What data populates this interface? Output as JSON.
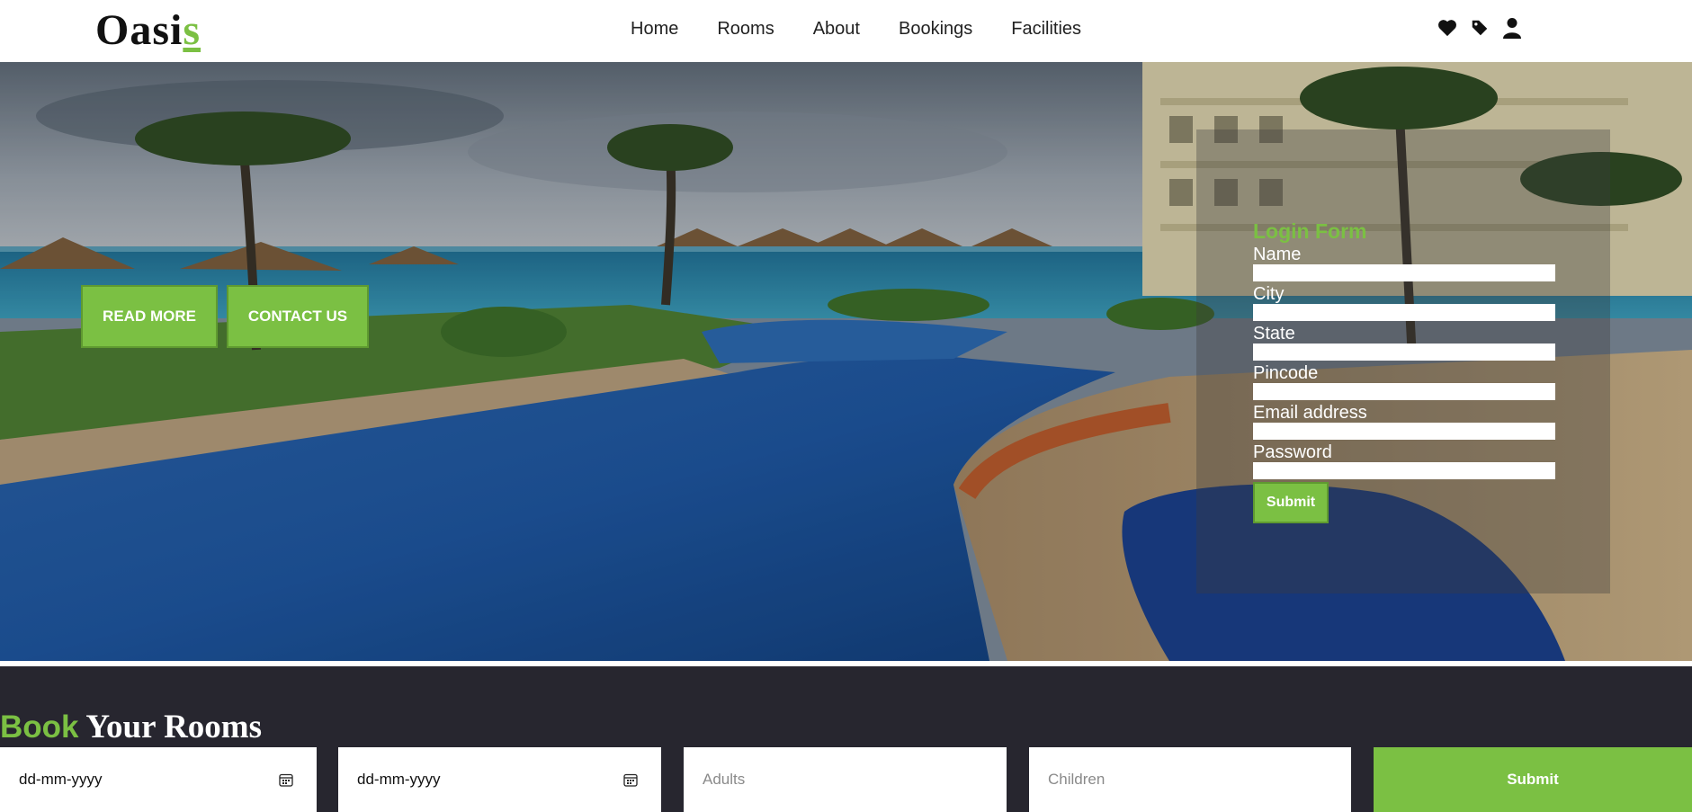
{
  "brand": {
    "name_main": "Oasi",
    "name_accent": "s"
  },
  "nav": {
    "links": [
      "Home",
      "Rooms",
      "About",
      "Bookings",
      "Facilities"
    ],
    "icons": [
      "heart-icon",
      "tag-icon",
      "user-icon"
    ]
  },
  "hero": {
    "read_more": "READ MORE",
    "contact_us": "CONTACT US"
  },
  "login": {
    "title": "Login Form",
    "fields": [
      "Name",
      "City",
      "State",
      "Pincode",
      "Email address",
      "Password"
    ],
    "submit": "Submit"
  },
  "booking": {
    "title_accent": "Book",
    "title_rest": " Your Rooms",
    "checkin_value": "dd-mm-yyyy",
    "checkout_value": "dd-mm-yyyy",
    "adults_placeholder": "Adults",
    "children_placeholder": "Children",
    "submit": "Submit"
  },
  "colors": {
    "accent": "#7bc043",
    "dark": "#27262f",
    "text": "#222222"
  }
}
